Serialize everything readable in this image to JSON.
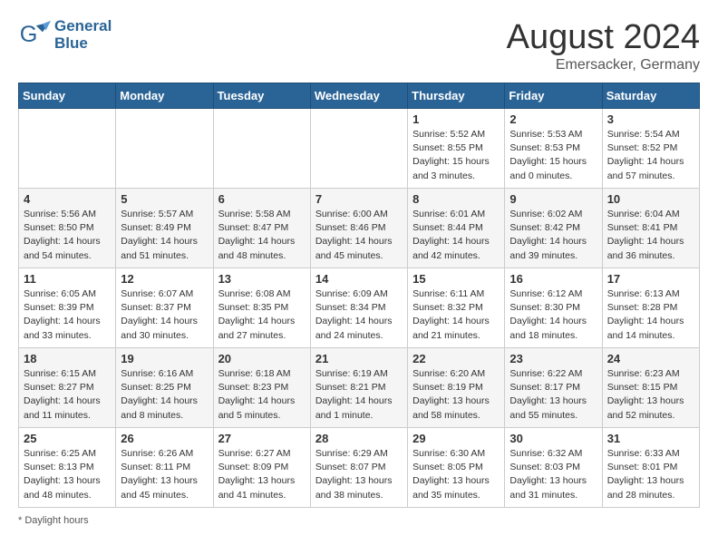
{
  "header": {
    "logo_line1": "General",
    "logo_line2": "Blue",
    "month": "August 2024",
    "location": "Emersacker, Germany"
  },
  "days_of_week": [
    "Sunday",
    "Monday",
    "Tuesday",
    "Wednesday",
    "Thursday",
    "Friday",
    "Saturday"
  ],
  "footer": {
    "note": "Daylight hours"
  },
  "weeks": [
    [
      {
        "day": "",
        "info": ""
      },
      {
        "day": "",
        "info": ""
      },
      {
        "day": "",
        "info": ""
      },
      {
        "day": "",
        "info": ""
      },
      {
        "day": "1",
        "info": "Sunrise: 5:52 AM\nSunset: 8:55 PM\nDaylight: 15 hours\nand 3 minutes."
      },
      {
        "day": "2",
        "info": "Sunrise: 5:53 AM\nSunset: 8:53 PM\nDaylight: 15 hours\nand 0 minutes."
      },
      {
        "day": "3",
        "info": "Sunrise: 5:54 AM\nSunset: 8:52 PM\nDaylight: 14 hours\nand 57 minutes."
      }
    ],
    [
      {
        "day": "4",
        "info": "Sunrise: 5:56 AM\nSunset: 8:50 PM\nDaylight: 14 hours\nand 54 minutes."
      },
      {
        "day": "5",
        "info": "Sunrise: 5:57 AM\nSunset: 8:49 PM\nDaylight: 14 hours\nand 51 minutes."
      },
      {
        "day": "6",
        "info": "Sunrise: 5:58 AM\nSunset: 8:47 PM\nDaylight: 14 hours\nand 48 minutes."
      },
      {
        "day": "7",
        "info": "Sunrise: 6:00 AM\nSunset: 8:46 PM\nDaylight: 14 hours\nand 45 minutes."
      },
      {
        "day": "8",
        "info": "Sunrise: 6:01 AM\nSunset: 8:44 PM\nDaylight: 14 hours\nand 42 minutes."
      },
      {
        "day": "9",
        "info": "Sunrise: 6:02 AM\nSunset: 8:42 PM\nDaylight: 14 hours\nand 39 minutes."
      },
      {
        "day": "10",
        "info": "Sunrise: 6:04 AM\nSunset: 8:41 PM\nDaylight: 14 hours\nand 36 minutes."
      }
    ],
    [
      {
        "day": "11",
        "info": "Sunrise: 6:05 AM\nSunset: 8:39 PM\nDaylight: 14 hours\nand 33 minutes."
      },
      {
        "day": "12",
        "info": "Sunrise: 6:07 AM\nSunset: 8:37 PM\nDaylight: 14 hours\nand 30 minutes."
      },
      {
        "day": "13",
        "info": "Sunrise: 6:08 AM\nSunset: 8:35 PM\nDaylight: 14 hours\nand 27 minutes."
      },
      {
        "day": "14",
        "info": "Sunrise: 6:09 AM\nSunset: 8:34 PM\nDaylight: 14 hours\nand 24 minutes."
      },
      {
        "day": "15",
        "info": "Sunrise: 6:11 AM\nSunset: 8:32 PM\nDaylight: 14 hours\nand 21 minutes."
      },
      {
        "day": "16",
        "info": "Sunrise: 6:12 AM\nSunset: 8:30 PM\nDaylight: 14 hours\nand 18 minutes."
      },
      {
        "day": "17",
        "info": "Sunrise: 6:13 AM\nSunset: 8:28 PM\nDaylight: 14 hours\nand 14 minutes."
      }
    ],
    [
      {
        "day": "18",
        "info": "Sunrise: 6:15 AM\nSunset: 8:27 PM\nDaylight: 14 hours\nand 11 minutes."
      },
      {
        "day": "19",
        "info": "Sunrise: 6:16 AM\nSunset: 8:25 PM\nDaylight: 14 hours\nand 8 minutes."
      },
      {
        "day": "20",
        "info": "Sunrise: 6:18 AM\nSunset: 8:23 PM\nDaylight: 14 hours\nand 5 minutes."
      },
      {
        "day": "21",
        "info": "Sunrise: 6:19 AM\nSunset: 8:21 PM\nDaylight: 14 hours\nand 1 minute."
      },
      {
        "day": "22",
        "info": "Sunrise: 6:20 AM\nSunset: 8:19 PM\nDaylight: 13 hours\nand 58 minutes."
      },
      {
        "day": "23",
        "info": "Sunrise: 6:22 AM\nSunset: 8:17 PM\nDaylight: 13 hours\nand 55 minutes."
      },
      {
        "day": "24",
        "info": "Sunrise: 6:23 AM\nSunset: 8:15 PM\nDaylight: 13 hours\nand 52 minutes."
      }
    ],
    [
      {
        "day": "25",
        "info": "Sunrise: 6:25 AM\nSunset: 8:13 PM\nDaylight: 13 hours\nand 48 minutes."
      },
      {
        "day": "26",
        "info": "Sunrise: 6:26 AM\nSunset: 8:11 PM\nDaylight: 13 hours\nand 45 minutes."
      },
      {
        "day": "27",
        "info": "Sunrise: 6:27 AM\nSunset: 8:09 PM\nDaylight: 13 hours\nand 41 minutes."
      },
      {
        "day": "28",
        "info": "Sunrise: 6:29 AM\nSunset: 8:07 PM\nDaylight: 13 hours\nand 38 minutes."
      },
      {
        "day": "29",
        "info": "Sunrise: 6:30 AM\nSunset: 8:05 PM\nDaylight: 13 hours\nand 35 minutes."
      },
      {
        "day": "30",
        "info": "Sunrise: 6:32 AM\nSunset: 8:03 PM\nDaylight: 13 hours\nand 31 minutes."
      },
      {
        "day": "31",
        "info": "Sunrise: 6:33 AM\nSunset: 8:01 PM\nDaylight: 13 hours\nand 28 minutes."
      }
    ]
  ]
}
